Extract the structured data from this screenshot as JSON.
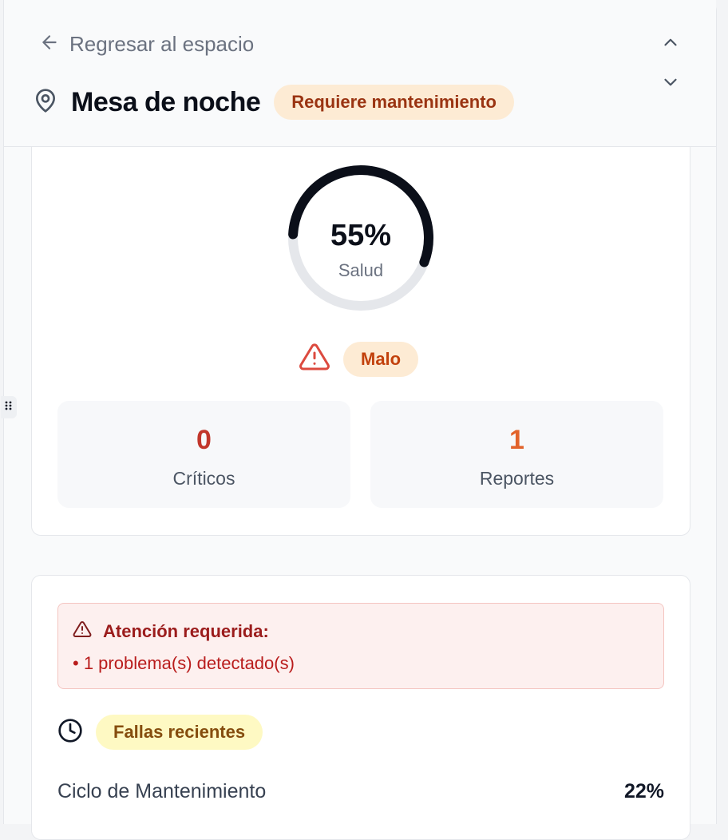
{
  "header": {
    "back_label": "Regresar al espacio",
    "title": "Mesa de noche",
    "status_badge": "Requiere mantenimiento"
  },
  "health": {
    "percent": 55,
    "percent_label": "55%",
    "label": "Salud",
    "status": "Malo"
  },
  "stats": [
    {
      "value": "0",
      "label": "Críticos",
      "color": "#c2362b"
    },
    {
      "value": "1",
      "label": "Reportes",
      "color": "#e2622a"
    }
  ],
  "alert": {
    "title": "Atención requerida:",
    "items": [
      "• 1 problema(s) detectado(s)"
    ]
  },
  "recent": {
    "badge": "Fallas recientes"
  },
  "maintenance": {
    "label": "Ciclo de Mantenimiento",
    "value": "22%"
  },
  "icons": {
    "back": "arrow-left-icon",
    "location": "map-pin-icon",
    "up": "chevron-up-icon",
    "down": "chevron-down-icon",
    "warning": "warning-triangle-icon",
    "clock": "clock-icon",
    "drag": "grip-dots-icon"
  },
  "colors": {
    "gauge_fill": "#0b0f19",
    "gauge_track": "#e5e7eb",
    "badge_warning_bg": "#fdebd4",
    "badge_warning_text": "#9a3412",
    "alert_bg": "#fdf0ef",
    "alert_border": "#f4c5c1"
  }
}
